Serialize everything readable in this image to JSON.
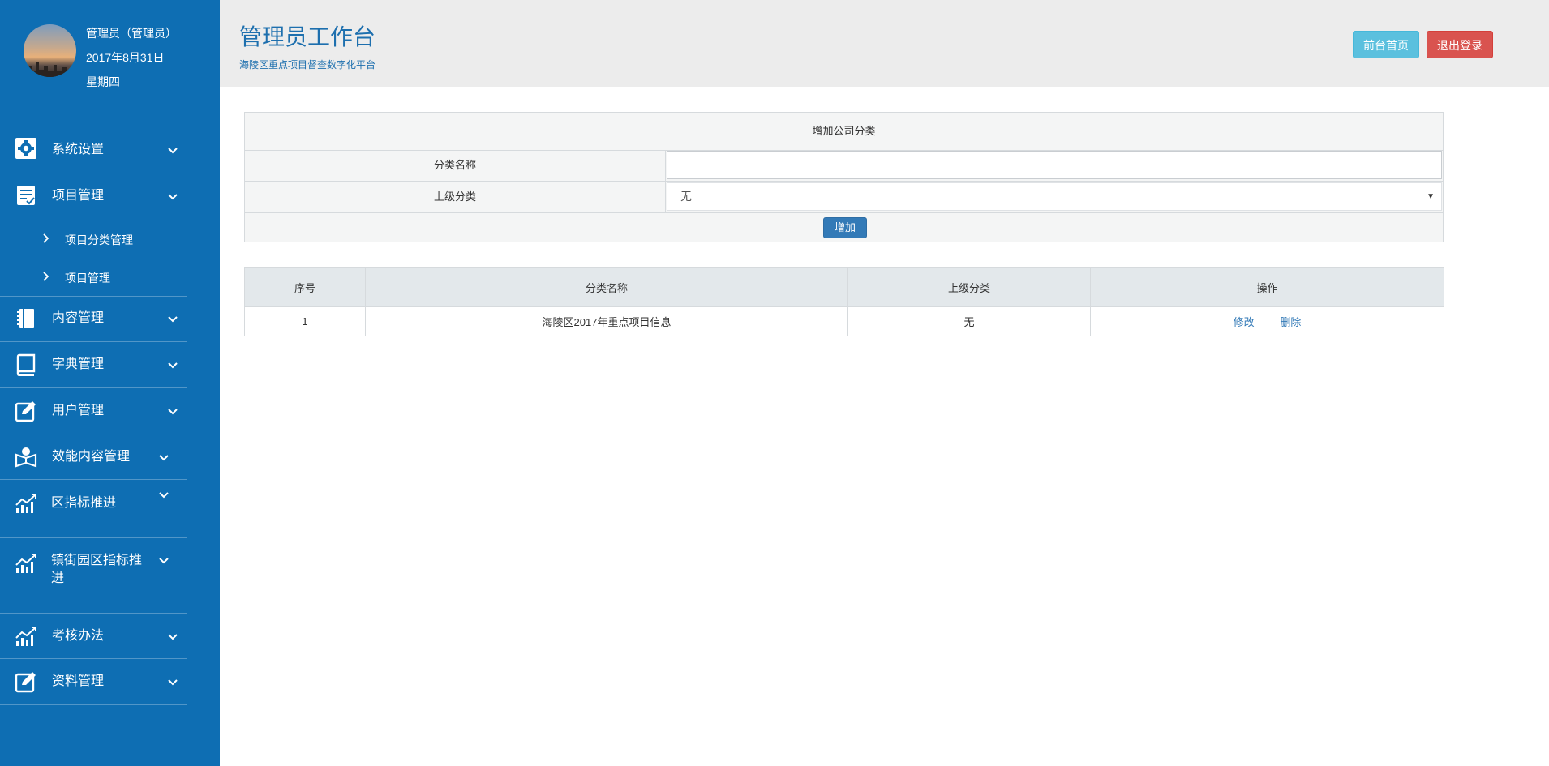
{
  "profile": {
    "name": "管理员（管理员）",
    "date": "2017年8月31日",
    "weekday": "星期四"
  },
  "sidebar": {
    "items": [
      {
        "label": "系统设置",
        "icon": "gear-icon"
      },
      {
        "label": "项目管理",
        "icon": "checklist-icon"
      },
      {
        "label": "内容管理",
        "icon": "notebook-icon"
      },
      {
        "label": "字典管理",
        "icon": "book-icon"
      },
      {
        "label": "用户管理",
        "icon": "edit-icon"
      },
      {
        "label": "效能内容管理",
        "icon": "reader-icon"
      },
      {
        "label": "区指标推进",
        "icon": "trend-icon"
      },
      {
        "label": "镇街园区指标推进",
        "icon": "trend-icon"
      },
      {
        "label": "考核办法",
        "icon": "trend-icon"
      },
      {
        "label": "资料管理",
        "icon": "edit-icon"
      }
    ],
    "sub_items": [
      {
        "label": "项目分类管理"
      },
      {
        "label": "项目管理"
      }
    ]
  },
  "header": {
    "title": "管理员工作台",
    "subtitle": "海陵区重点项目督查数字化平台",
    "home_button": "前台首页",
    "logout_button": "退出登录"
  },
  "form": {
    "title": "增加公司分类",
    "name_label": "分类名称",
    "name_value": "",
    "parent_label": "上级分类",
    "parent_selected": "无",
    "add_button": "增加"
  },
  "table": {
    "headers": [
      "序号",
      "分类名称",
      "上级分类",
      "操作"
    ],
    "rows": [
      {
        "index": "1",
        "name": "海陵区2017年重点项目信息",
        "parent": "无",
        "edit": "修改",
        "delete": "删除"
      }
    ]
  },
  "colors": {
    "sidebar": "#0e6eb3",
    "header_bg": "#ececec",
    "title": "#1d6fae",
    "home_button": "#5bc0de",
    "logout_button": "#d9534f",
    "add_button": "#337ab7",
    "link": "#337ab7"
  }
}
